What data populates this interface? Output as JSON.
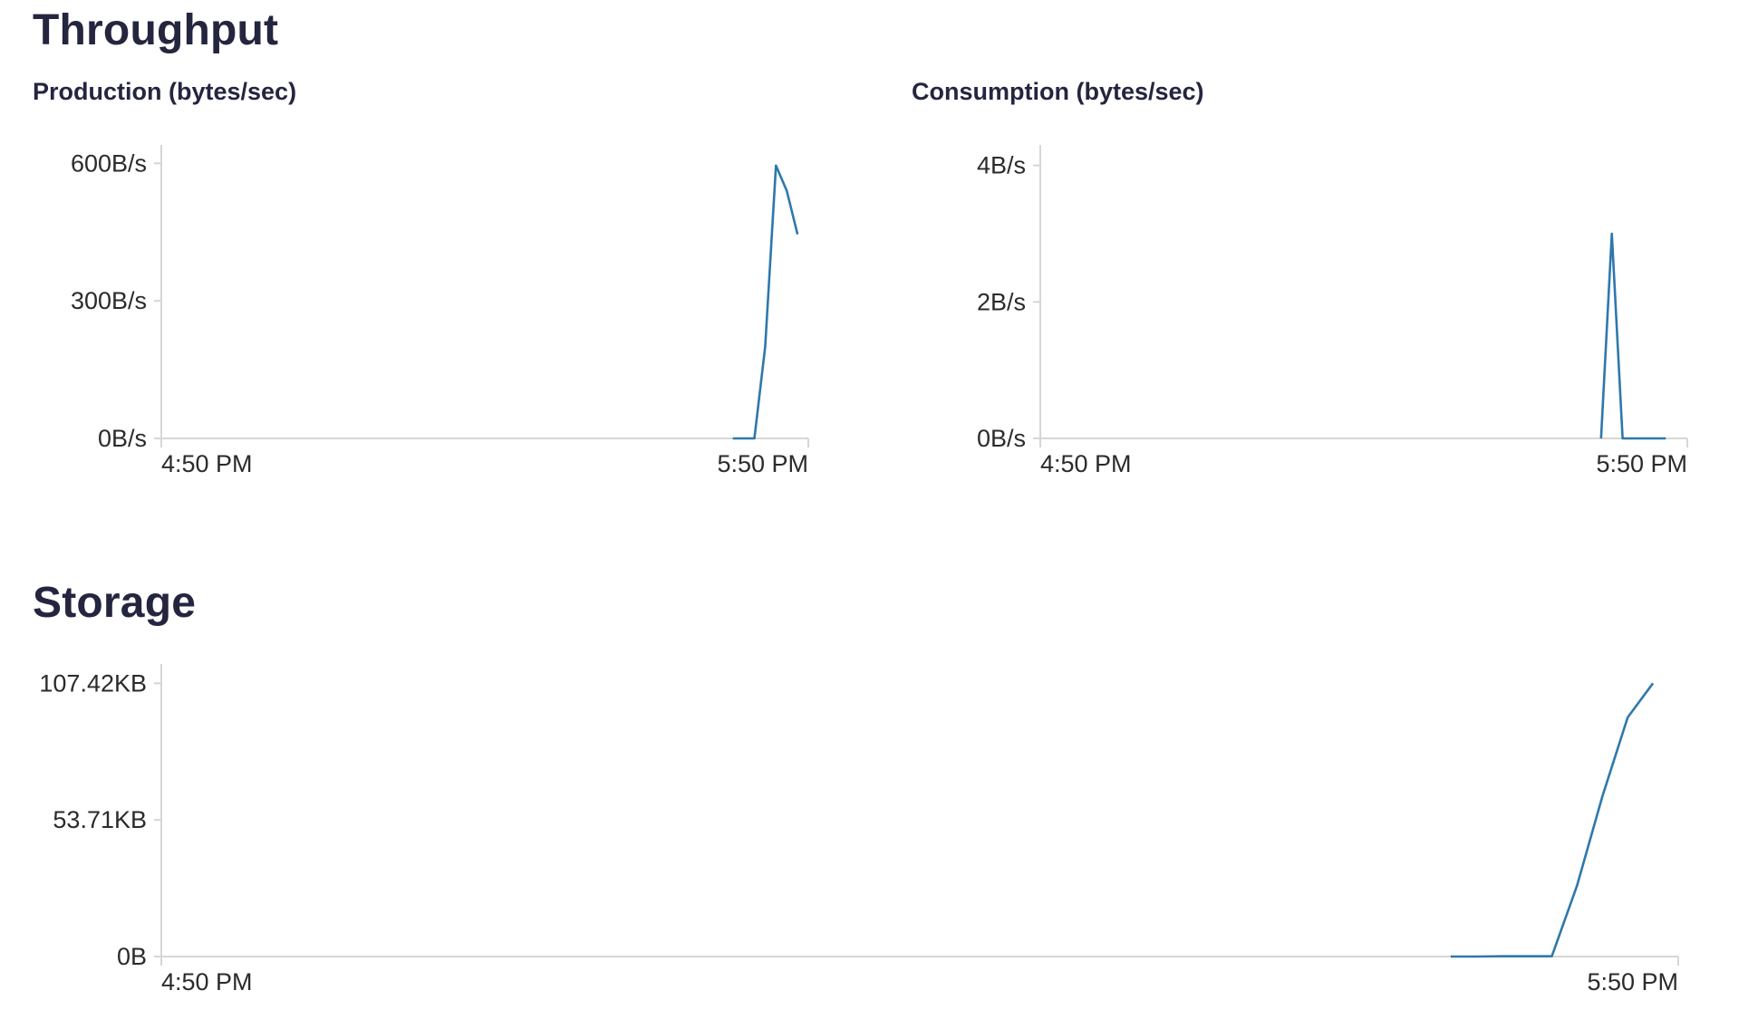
{
  "sections": {
    "throughput": "Throughput",
    "storage": "Storage"
  },
  "chart_data": [
    {
      "type": "line",
      "title": "Production (bytes/sec)",
      "xlabel": "",
      "ylabel": "",
      "x_ticks": [
        "4:50 PM",
        "5:50 PM"
      ],
      "y_ticks": [
        "0B/s",
        "300B/s",
        "600B/s"
      ],
      "xlim": [
        "4:50 PM",
        "5:50 PM"
      ],
      "ylim": [
        0,
        640
      ],
      "x_unit": "minutes after 4:50 PM",
      "x": [
        53,
        55,
        56,
        57,
        58,
        59
      ],
      "values": [
        0,
        0,
        200,
        595,
        540,
        445
      ],
      "color": "#2e78ac",
      "grid": false,
      "legend": "none"
    },
    {
      "type": "line",
      "title": "Consumption (bytes/sec)",
      "xlabel": "",
      "ylabel": "",
      "x_ticks": [
        "4:50 PM",
        "5:50 PM"
      ],
      "y_ticks": [
        "0B/s",
        "2B/s",
        "4B/s"
      ],
      "xlim": [
        "4:50 PM",
        "5:50 PM"
      ],
      "ylim": [
        0,
        4.3
      ],
      "x_unit": "minutes after 4:50 PM",
      "x": [
        52,
        53,
        54,
        55,
        56,
        57,
        58
      ],
      "values": [
        0,
        3,
        0,
        0,
        0,
        0,
        0
      ],
      "color": "#2e78ac",
      "grid": false,
      "legend": "none"
    },
    {
      "type": "line",
      "title": "",
      "xlabel": "",
      "ylabel": "",
      "x_ticks": [
        "4:50 PM",
        "5:50 PM"
      ],
      "y_ticks": [
        "0B",
        "53.71KB",
        "107.42KB"
      ],
      "xlim": [
        "4:50 PM",
        "5:50 PM"
      ],
      "ylim": [
        0,
        115
      ],
      "x_unit": "minutes after 4:50 PM",
      "x": [
        51,
        52,
        53,
        54,
        55,
        56,
        57,
        58,
        59
      ],
      "values": [
        0,
        0,
        0.1,
        0.1,
        0.1,
        28,
        63,
        94,
        107.42
      ],
      "color": "#2e78ac",
      "grid": false,
      "legend": "none"
    }
  ]
}
